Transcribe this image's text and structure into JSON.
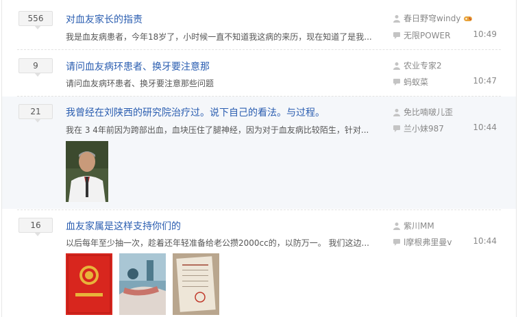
{
  "threads": [
    {
      "replies": "556",
      "title": "对血友家长的指责",
      "excerpt": "我是血友病患者，今年18岁了，小时候一直不知道我这病的来历，现在知道了是我...",
      "author": "春日野穹windy",
      "last_user": "无限POWER",
      "time": "10:49"
    },
    {
      "replies": "9",
      "title": "请问血友病环患者、换牙要注意那",
      "excerpt": "请问血友病环患者、换牙要注意那些问题",
      "author": "农业专家2",
      "last_user": "蚂蚁菜",
      "time": "10:47"
    },
    {
      "replies": "21",
      "title": "我曾经在刘陕西的研究院治疗过。说下自己的看法。与过程。",
      "excerpt": "我在 3 4年前因为跨部出血，血块压住了腿神经，因为对于血友病比较陌生，针对...",
      "author": "免比喃啵儿歪",
      "last_user": "兰小妹987",
      "time": "10:44"
    },
    {
      "replies": "16",
      "title": "血友家属是这样支持你们的",
      "excerpt": "以后每年至少抽一次，趁着还年轻准备给老公攒2000cc的，以防万一。 我们这边...",
      "author": "紫川MM",
      "last_user": "l摩根弗里曼v",
      "time": "10:44"
    }
  ],
  "icons": {
    "author": "person-icon",
    "last_user": "reply-bubble-icon",
    "badge": "game-controller-icon"
  },
  "colors": {
    "title_link": "#2a5db0",
    "highlight_row": "#f5f7fa",
    "meta_text": "#888888"
  }
}
